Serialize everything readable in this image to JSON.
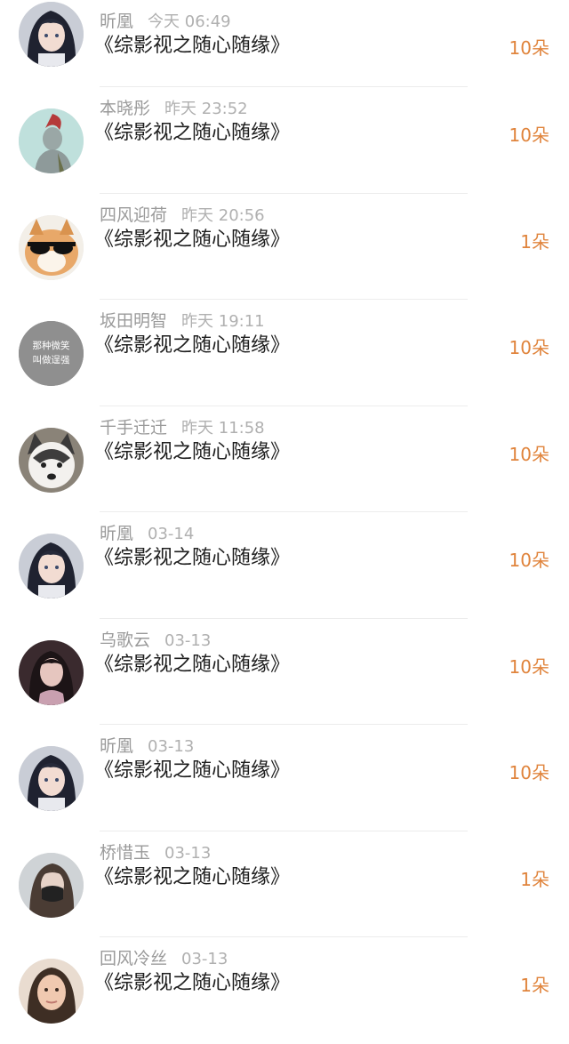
{
  "items": [
    {
      "name": "昕凰",
      "time": "今天 06:49",
      "book": "《综影视之随心随缘》",
      "count": "10朵",
      "avatar": "anime-girl-icon"
    },
    {
      "name": "本晓彤",
      "time": "昨天 23:52",
      "book": "《综影视之随心随缘》",
      "count": "10朵",
      "avatar": "anime-boy-icon"
    },
    {
      "name": "四风迎荷",
      "time": "昨天 20:56",
      "book": "《综影视之随心随缘》",
      "count": "1朵",
      "avatar": "cat-sunglasses-icon"
    },
    {
      "name": "坂田明智",
      "time": "昨天 19:11",
      "book": "《综影视之随心随缘》",
      "count": "10朵",
      "avatar": "text-avatar-icon",
      "avatar_text": [
        "那种微笑",
        "叫做逞强"
      ]
    },
    {
      "name": "千手迁迁",
      "time": "昨天 11:58",
      "book": "《综影视之随心随缘》",
      "count": "10朵",
      "avatar": "husky-dog-icon"
    },
    {
      "name": "昕凰",
      "time": "03-14",
      "book": "《综影视之随心随缘》",
      "count": "10朵",
      "avatar": "anime-girl-icon"
    },
    {
      "name": "乌歌云",
      "time": "03-13",
      "book": "《综影视之随心随缘》",
      "count": "10朵",
      "avatar": "dark-hair-girl-icon"
    },
    {
      "name": "昕凰",
      "time": "03-13",
      "book": "《综影视之随心随缘》",
      "count": "10朵",
      "avatar": "anime-girl-icon"
    },
    {
      "name": "桥惜玉",
      "time": "03-13",
      "book": "《综影视之随心随缘》",
      "count": "1朵",
      "avatar": "masked-girl-icon"
    },
    {
      "name": "回风冷丝",
      "time": "03-13",
      "book": "《综影视之随心随缘》",
      "count": "1朵",
      "avatar": "selfie-woman-icon"
    }
  ],
  "colors": {
    "count": "#e0843c",
    "name": "#9a9a9a",
    "book": "#1e1e1e",
    "divider": "#ececec"
  }
}
